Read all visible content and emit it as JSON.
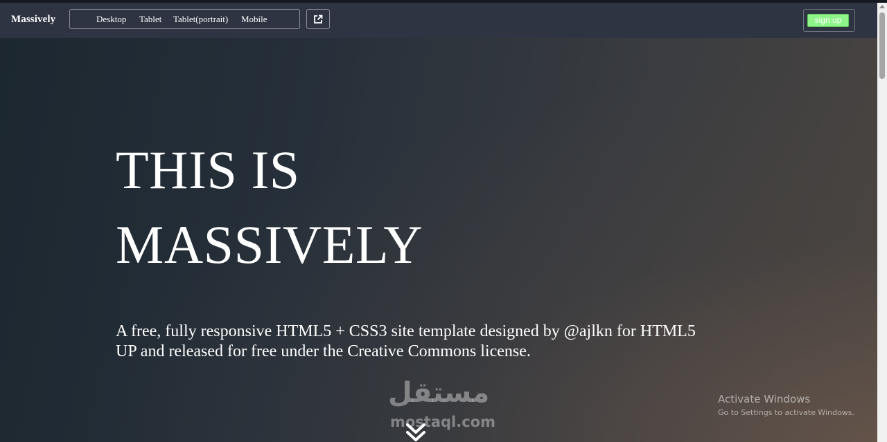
{
  "toolbar": {
    "brand": "Massively",
    "devices": [
      "Desktop",
      "Tablet",
      "Tablet(portrait)",
      "Mobile"
    ],
    "popout_icon": "external-link-icon",
    "signup_label": "sign up"
  },
  "hero": {
    "title_line1": "THIS IS",
    "title_line2": "MASSIVELY",
    "subtitle_line1": "A free, fully responsive HTML5 + CSS3 site template designed by @ajlkn for HTML5",
    "subtitle_line2": "UP and released for free under the Creative Commons license.",
    "scroll_icon": "double-chevron-down-icon"
  },
  "watermark": {
    "arabic": "مستقل",
    "latin": "mostaql.com"
  },
  "os_notice": {
    "title": "Activate Windows",
    "subtitle": "Go to Settings to activate Windows."
  },
  "colors": {
    "toolbar_bg": "#2e3442",
    "signup_bg": "#8ff58a",
    "hero_dark": "#1c2730",
    "hero_warm": "#4a4541"
  }
}
